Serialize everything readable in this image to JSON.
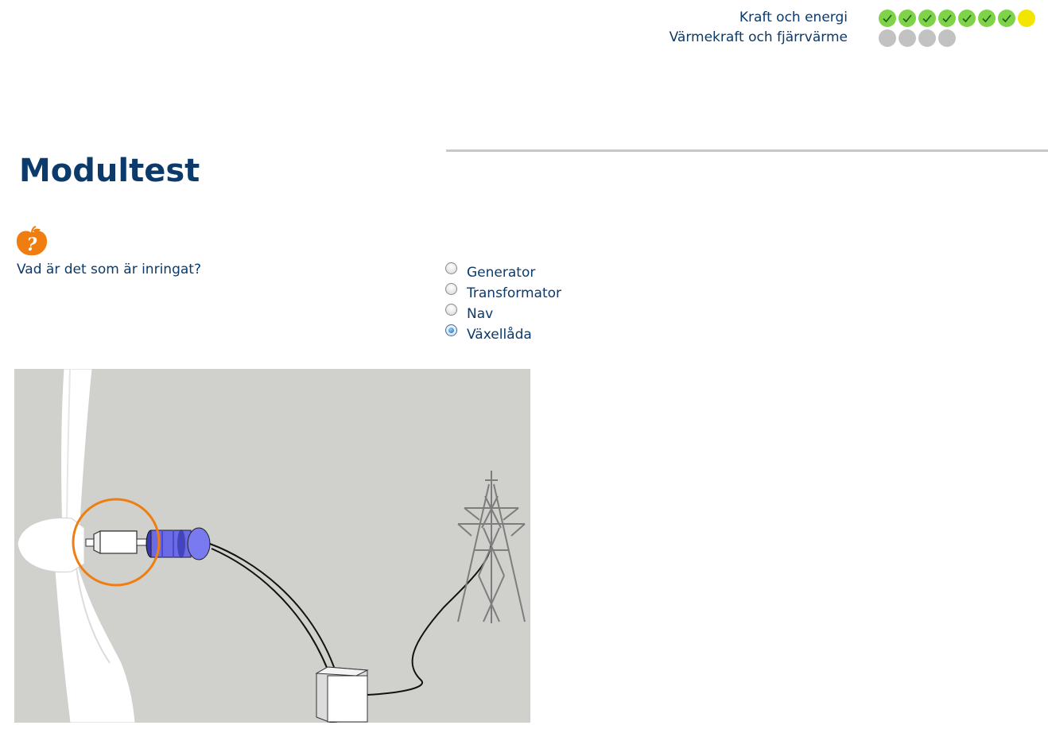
{
  "progress": {
    "rows": [
      {
        "label": "Kraft och energi",
        "dots": [
          "done",
          "done",
          "done",
          "done",
          "done",
          "done",
          "done",
          "current"
        ]
      },
      {
        "label": "Värmekraft och fjärrvärme",
        "dots": [
          "todo",
          "todo",
          "todo",
          "todo"
        ]
      }
    ],
    "colors": {
      "done": "#7ed348",
      "current": "#f2e600",
      "todo": "#c2c2c2"
    }
  },
  "page": {
    "title": "Modultest"
  },
  "question": {
    "icon": "question-apple-icon",
    "text": "Vad är det som är inringat?",
    "options": [
      {
        "label": "Generator",
        "selected": false
      },
      {
        "label": "Transformator",
        "selected": false
      },
      {
        "label": "Nav",
        "selected": false
      },
      {
        "label": "Växellåda",
        "selected": true
      }
    ]
  },
  "figure": {
    "description_icon": "wind-turbine-diagram-icon",
    "highlight_color": "#f07d10"
  }
}
